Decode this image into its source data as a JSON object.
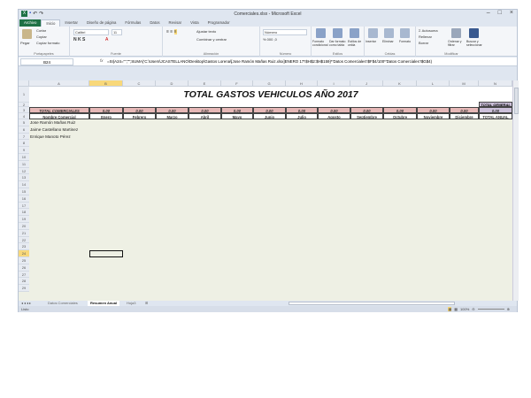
{
  "window": {
    "title": "Comerciales.xlsx - Microsoft Excel"
  },
  "tabs": [
    "Archivo",
    "Inicio",
    "Insertar",
    "Diseño de página",
    "Fórmulas",
    "Datos",
    "Revisar",
    "Vista",
    "Programador"
  ],
  "ribbon": {
    "clipboard": {
      "paste": "Pegar",
      "cut": "Cortar",
      "copy": "Copiar",
      "format_painter": "Copiar formato",
      "label": "Portapapeles"
    },
    "font": {
      "name": "Calibri",
      "size": "11",
      "label": "Fuente"
    },
    "alignment": {
      "wrap": "Ajustar texto",
      "merge": "Combinar y centrar",
      "label": "Alineación"
    },
    "number": {
      "format": "Número",
      "label": "Número"
    },
    "styles": {
      "conditional": "Formato condicional",
      "table": "Dar formato como tabla",
      "cell_styles": "Estilos de celda",
      "label": "Estilos"
    },
    "cells": {
      "insert": "Insertar",
      "delete": "Eliminar",
      "format": "Formato",
      "label": "Celdas"
    },
    "editing": {
      "autosum": "Autosuma",
      "fill": "Rellenar",
      "clear": "Borrar",
      "sort": "Ordenar y filtrar",
      "find": "Buscar y seleccionar",
      "label": "Modificar"
    }
  },
  "formula_bar": {
    "name_box": "B24",
    "fx": "fx",
    "formula": "=SI(A24=\"\";\"\";SUMA('C:\\Users\\JCASTELLANO\\Desktop\\Gastos Lorena\\[Jose Ramón Mañas Ruiz.xlsx]ENERO 17'!$H$2:$H$159)*'Datos Comerciales'!$F$4/100*'Datos Comerciales'!$G$4)"
  },
  "columns": [
    "A",
    "B",
    "C",
    "D",
    "E",
    "F",
    "G",
    "H",
    "I",
    "J",
    "K",
    "L",
    "M",
    "N"
  ],
  "selected_column": "B",
  "rows": [
    1,
    2,
    3,
    4,
    5,
    6,
    7,
    8,
    9,
    10,
    11,
    12,
    13,
    14,
    15,
    16,
    17,
    18,
    19,
    20,
    21,
    22,
    23,
    24,
    25,
    26,
    27,
    28,
    29
  ],
  "selected_row": 24,
  "sheet": {
    "title": "TOTAL GASTOS VEHICULOS AÑO 2017",
    "total_general_label": "TOTAL GENERAL",
    "row3": [
      "TOTAL COMERCIALES",
      "0,00",
      "0,00",
      "0,00",
      "0,00",
      "0,00",
      "0,00",
      "0,00",
      "0,00",
      "0,00",
      "0,00",
      "0,00",
      "0,00",
      "0,00"
    ],
    "row4": [
      "Nombre Comercial",
      "Enero",
      "Febrero",
      "Marzo",
      "Abril",
      "Mayo",
      "Junio",
      "Julio",
      "Agosto",
      "Septiembre",
      "Octubre",
      "Noviembre",
      "Diciembre",
      "TOTAL ANUAL"
    ],
    "names": [
      "Jose Ramón Mañas Ruiz",
      "Jaime Castellano Martinez",
      "Enrique Manoto Pérez"
    ]
  },
  "sheet_tabs": [
    {
      "label": "Datos Comerciales"
    },
    {
      "label": "Resumen Anual",
      "active": true
    },
    {
      "label": "Hoja3"
    }
  ],
  "status": {
    "mode": "Listo",
    "zoom": "100%"
  }
}
